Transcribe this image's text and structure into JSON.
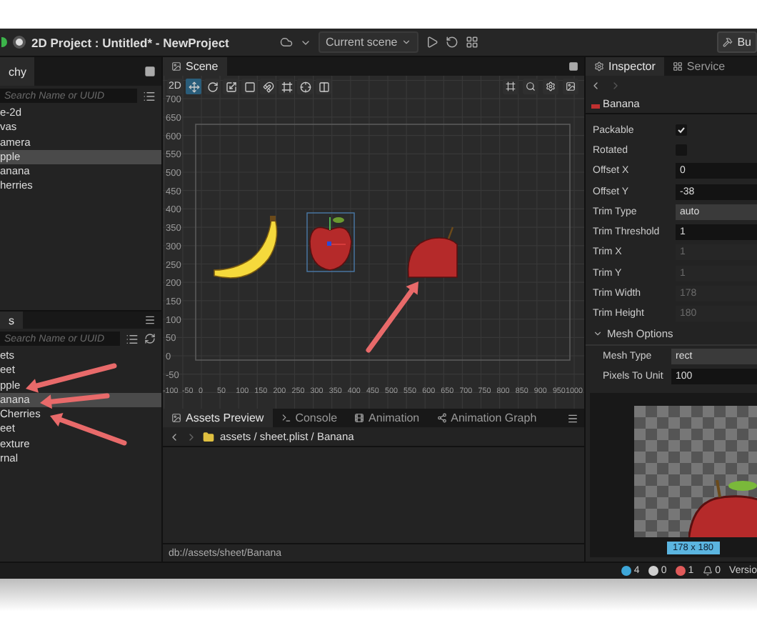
{
  "window": {
    "title": "2D Project : Untitled* - NewProject"
  },
  "toolbar": {
    "scene_select": "Current scene",
    "build_button": "Bu"
  },
  "hierarchy": {
    "tab": "chy",
    "search": {
      "placeholder": "Search Name or UUID"
    },
    "items": [
      {
        "label": "e-2d",
        "selected": false
      },
      {
        "label": "vas",
        "selected": false
      },
      {
        "label": "amera",
        "selected": false
      },
      {
        "label": "pple",
        "selected": true
      },
      {
        "label": "anana",
        "selected": false
      },
      {
        "label": "herries",
        "selected": false
      }
    ]
  },
  "assets": {
    "tab": "s",
    "search": {
      "placeholder": "Search Name or UUID"
    },
    "items": [
      {
        "label": "ets",
        "selected": false
      },
      {
        "label": "eet",
        "selected": false
      },
      {
        "label": "pple",
        "selected": false
      },
      {
        "label": "anana",
        "selected": true
      },
      {
        "label": "Cherries",
        "selected": false
      },
      {
        "label": "eet",
        "selected": false
      },
      {
        "label": "exture",
        "selected": false
      },
      {
        "label": "rnal",
        "selected": false
      }
    ]
  },
  "scene": {
    "tab": "Scene",
    "mode": "2D",
    "tools": [
      {
        "kind": "move",
        "selected": true
      },
      {
        "kind": "rotate",
        "selected": false
      },
      {
        "kind": "scale",
        "selected": false
      },
      {
        "kind": "rect",
        "selected": false
      },
      {
        "kind": "magnet",
        "selected": false
      },
      {
        "kind": "frame",
        "selected": false
      },
      {
        "kind": "pivot",
        "selected": false
      },
      {
        "kind": "align",
        "selected": false
      }
    ],
    "y_labels": [
      "700",
      "650",
      "600",
      "550",
      "500",
      "450",
      "400",
      "350",
      "300",
      "250",
      "200",
      "150",
      "100",
      "50",
      "0",
      "-50"
    ],
    "x_labels": [
      "-100",
      "-50",
      "0",
      "50",
      "100",
      "150",
      "200",
      "250",
      "300",
      "350",
      "400",
      "450",
      "500",
      "550",
      "600",
      "650",
      "700",
      "750",
      "800",
      "850",
      "900",
      "950",
      "1000"
    ]
  },
  "bottom_panel": {
    "tabs": [
      {
        "label": "Assets Preview",
        "kind": "preview",
        "selected": true
      },
      {
        "label": "Console",
        "kind": "console",
        "selected": false
      },
      {
        "label": "Animation",
        "kind": "animation",
        "selected": false
      },
      {
        "label": "Animation Graph",
        "kind": "graph",
        "selected": false
      }
    ],
    "breadcrumb": "assets / sheet.plist / Banana",
    "path": "db://assets/sheet/Banana"
  },
  "inspector": {
    "tabs": [
      {
        "label": "Inspector",
        "selected": true
      },
      {
        "label": "Service",
        "selected": false
      }
    ],
    "asset_name": "Banana",
    "properties": [
      {
        "label": "Packable",
        "kind": "checkbox",
        "checked": true
      },
      {
        "label": "Rotated",
        "kind": "checkbox",
        "checked": false
      },
      {
        "label": "Offset X",
        "kind": "field",
        "value": "0",
        "disabled": false
      },
      {
        "label": "Offset Y",
        "kind": "field",
        "value": "-38",
        "disabled": false
      },
      {
        "label": "Trim Type",
        "kind": "select",
        "value": "auto"
      },
      {
        "label": "Trim Threshold",
        "kind": "field",
        "value": "1",
        "disabled": false
      },
      {
        "label": "Trim X",
        "kind": "field",
        "value": "1",
        "disabled": true
      },
      {
        "label": "Trim Y",
        "kind": "field",
        "value": "1",
        "disabled": true
      },
      {
        "label": "Trim Width",
        "kind": "field",
        "value": "178",
        "disabled": true
      },
      {
        "label": "Trim Height",
        "kind": "field",
        "value": "180",
        "disabled": true
      }
    ],
    "mesh_options": {
      "label": "Mesh Options",
      "expanded": true,
      "properties": [
        {
          "label": "Mesh Type",
          "kind": "select",
          "value": "rect"
        },
        {
          "label": "Pixels To Unit",
          "kind": "field",
          "value": "100",
          "disabled": false
        }
      ]
    },
    "preview_size": "178 x 180"
  },
  "status_bar": {
    "counters": [
      {
        "kind": "info",
        "count": "4"
      },
      {
        "kind": "warning",
        "count": "0"
      },
      {
        "kind": "error",
        "count": "1"
      },
      {
        "kind": "notification",
        "count": "0"
      }
    ],
    "version": "Versio"
  }
}
